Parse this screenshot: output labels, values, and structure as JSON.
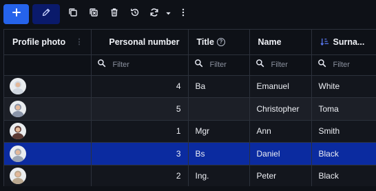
{
  "toolbar": {
    "add": "add",
    "edit": "edit",
    "copy": "copy",
    "delete_selection": "delete-selection",
    "delete": "delete",
    "history": "history",
    "refresh": "refresh",
    "refresh_menu": "chevron-down",
    "more": "more-vertical"
  },
  "columns": {
    "photo": "Profile photo",
    "personal_number": "Personal number",
    "title": "Title",
    "name": "Name",
    "surname": "Surna..."
  },
  "filters": {
    "placeholder": "Filter"
  },
  "rows": [
    {
      "personal_number": "4",
      "title": "Ba",
      "name": "Emanuel",
      "surname": "White",
      "avatar_color": "#cfd6df",
      "selected": false
    },
    {
      "personal_number": "5",
      "title": "",
      "name": "Christopher",
      "surname": "Toma",
      "avatar_color": "#8a94a8",
      "selected": false
    },
    {
      "personal_number": "1",
      "title": "Mgr",
      "name": "Ann",
      "surname": "Smith",
      "avatar_color": "#5b3a34",
      "selected": false
    },
    {
      "personal_number": "3",
      "title": "Bs",
      "name": "Daniel",
      "surname": "Black",
      "avatar_color": "#9aa4b3",
      "selected": true
    },
    {
      "personal_number": "2",
      "title": "Ing.",
      "name": "Peter",
      "surname": "Black",
      "avatar_color": "#b9a78f",
      "selected": false
    }
  ],
  "colors": {
    "primary": "#2563eb",
    "selected_row": "#0b2ba0",
    "background": "#0e1117"
  }
}
